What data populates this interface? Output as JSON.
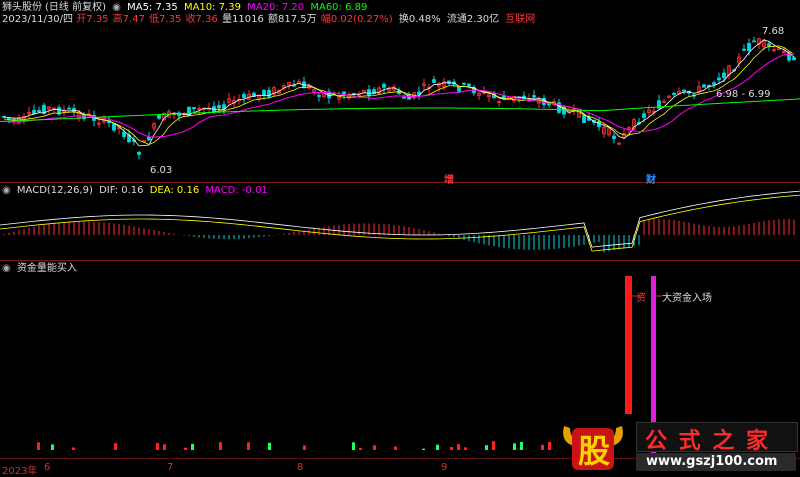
{
  "header": {
    "stock_name": "狮头股份",
    "chart_mode": "(日线 前复权)",
    "ma5_label": "MA5: 7.35",
    "ma10_label": "MA10: 7.39",
    "ma20_label": "MA20: 7.20",
    "ma60_label": "MA60: 6.89"
  },
  "quote_line": {
    "date": "2023/11/30/四",
    "open": "开7.35",
    "high": "高7.47",
    "low": "低7.35",
    "close": "收7.36",
    "volume": "量11016",
    "amount": "额817.5万",
    "change": "幅0.02(0.27%)",
    "turnover": "换0.48%",
    "float": "流通2.30亿",
    "source": "互联网"
  },
  "price_panel": {
    "high_marker": "7.68",
    "low_marker": "6.03",
    "range_marker": "6.98 - 6.99",
    "badge_zeng": "增",
    "badge_cai": "财"
  },
  "macd_panel": {
    "title": "MACD(12,26,9)",
    "dif": "DIF: 0.16",
    "dea": "DEA: 0.16",
    "macd": "MACD: -0.01"
  },
  "indicator_panel": {
    "title": "资金量能买入",
    "signal1": "资",
    "signal2": "大资金入场"
  },
  "x_axis": {
    "year": "2023年",
    "months": [
      "6",
      "7",
      "8",
      "9"
    ]
  },
  "watermark": {
    "glyph": "股",
    "text": "公 式 之 家",
    "url": "www.gszj100.com"
  },
  "colors": {
    "up": "#ff3030",
    "down": "#00d8e0",
    "ma5": "#ffffff",
    "ma10": "#ffff00",
    "ma20": "#ff00ff",
    "ma60": "#00ff00"
  }
}
